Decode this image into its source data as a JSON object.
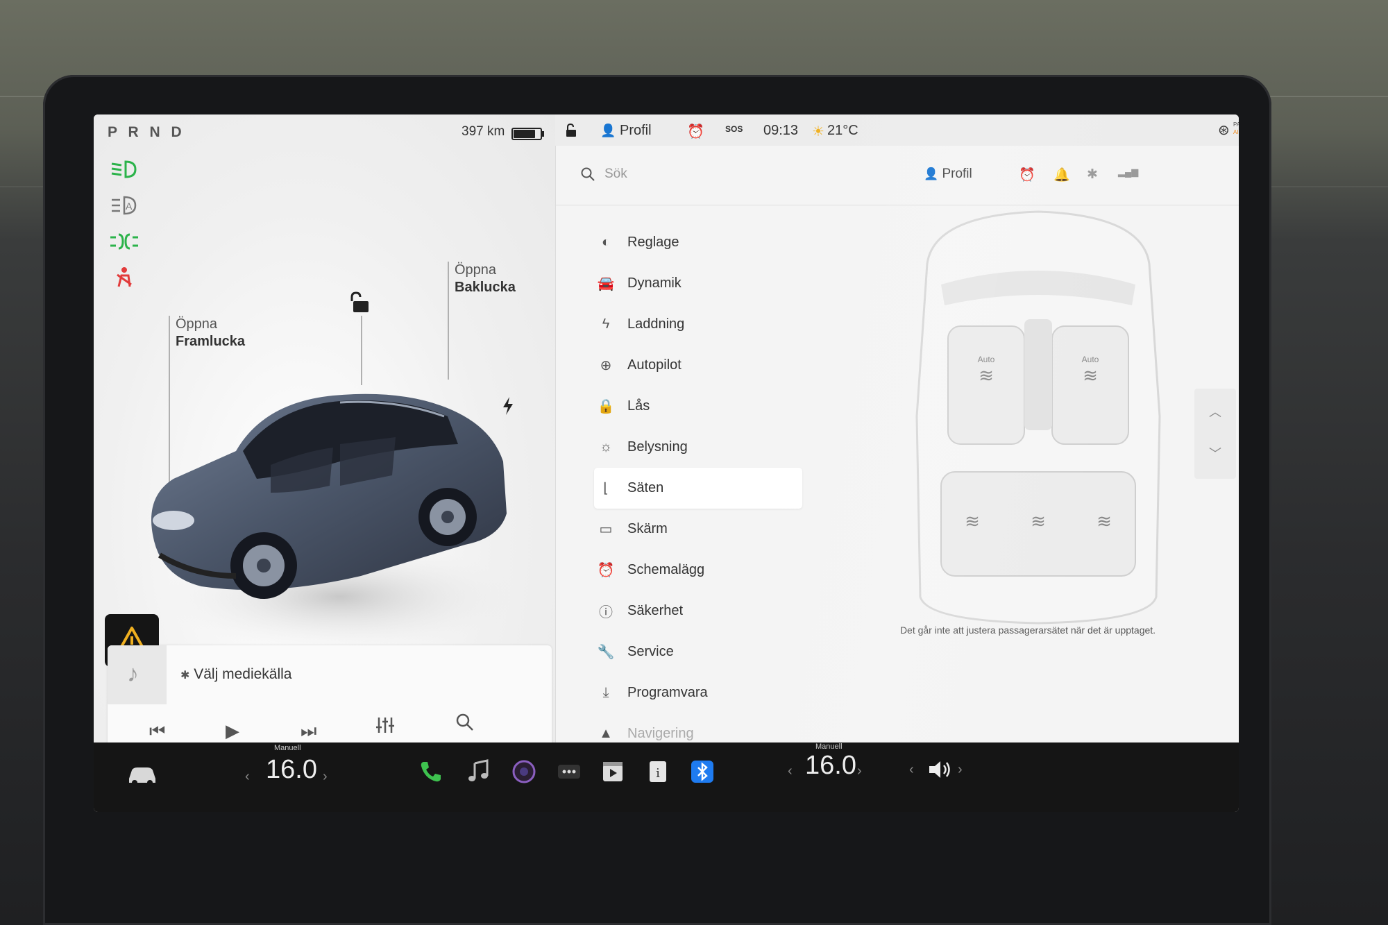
{
  "status_left": {
    "gear": "P R N D",
    "range": "397 km",
    "battery_level": 0.85
  },
  "status_right": {
    "profile": "Profil",
    "sos": "SOS",
    "time": "09:13",
    "temperature": "21°C",
    "airbag_line1": "PASSENGER",
    "airbag_line2": "AIRBAG ON"
  },
  "callouts": {
    "front_action": "Öppna",
    "front_target": "Framlucka",
    "rear_action": "Öppna",
    "rear_target": "Baklucka"
  },
  "media": {
    "title": "Välj mediekälla"
  },
  "settings": {
    "search_placeholder": "Sök",
    "profile": "Profil",
    "menu": [
      {
        "label": "Reglage",
        "icon": "toggle-icon"
      },
      {
        "label": "Dynamik",
        "icon": "car-icon"
      },
      {
        "label": "Laddning",
        "icon": "bolt-icon"
      },
      {
        "label": "Autopilot",
        "icon": "steering-wheel-icon"
      },
      {
        "label": "Lås",
        "icon": "lock-icon"
      },
      {
        "label": "Belysning",
        "icon": "sun-icon"
      },
      {
        "label": "Säten",
        "icon": "seat-icon"
      },
      {
        "label": "Skärm",
        "icon": "display-icon"
      },
      {
        "label": "Schemalägg",
        "icon": "alarm-icon"
      },
      {
        "label": "Säkerhet",
        "icon": "info-icon"
      },
      {
        "label": "Service",
        "icon": "wrench-icon"
      },
      {
        "label": "Programvara",
        "icon": "download-icon"
      },
      {
        "label": "Navigering",
        "icon": "navigation-icon"
      }
    ],
    "selected": "Säten",
    "seat_label_driver": "Auto",
    "seat_label_passenger": "Auto",
    "seat_note": "Det går inte att justera passagerarsätet när det är upptaget."
  },
  "climate": {
    "left": {
      "mode": "Manuell",
      "temp": "16.0"
    },
    "right": {
      "mode": "Manuell",
      "temp": "16.0"
    }
  },
  "colors": {
    "phone": "#3ec24f",
    "bluetooth": "#1e7bf0",
    "accent_orange": "#f08a1c",
    "green_tell": "#2bb34a",
    "red_tell": "#e23b3b"
  }
}
